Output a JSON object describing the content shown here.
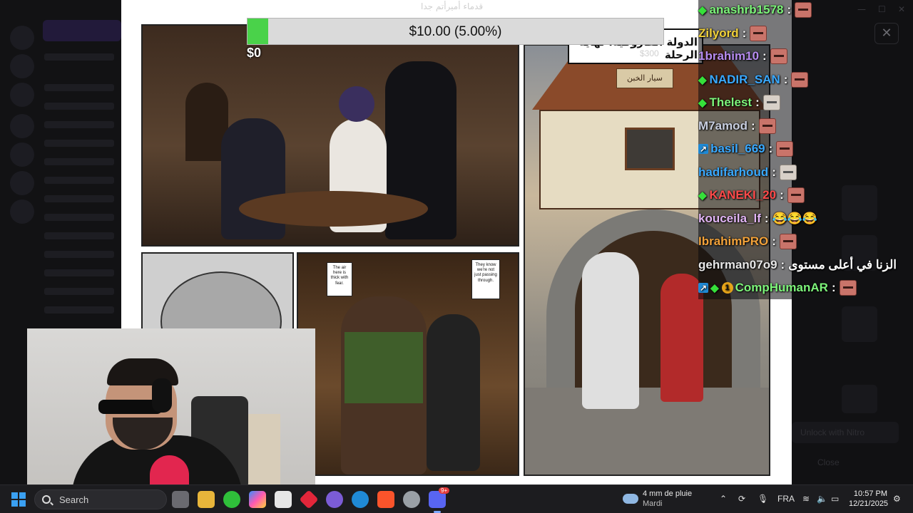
{
  "manga": {
    "header_text": "قدماء أميرأتم جدا",
    "banner_text": "الدولة الفاروقية: نهاية الرحلة",
    "sign_text": "سيار الخبن",
    "bubble1": "The air here is thick with fear.",
    "bubble2": "They know we're not just passing through."
  },
  "donation_goal": {
    "label": "$10.00 (5.00%)",
    "min_label": "$0",
    "max_label": "$300",
    "progress_fraction": 0.05,
    "fill_color": "#4ad24a"
  },
  "chat": {
    "messages": [
      {
        "badges": [
          "green"
        ],
        "user": "anashrb1578",
        "color": "#7df47a",
        "emotes": [
          "face"
        ],
        "text": ""
      },
      {
        "badges": [],
        "user": "Zilyord",
        "color": "#f2d23a",
        "emotes": [
          "face"
        ],
        "text": ""
      },
      {
        "badges": [],
        "user": "1brahim10",
        "color": "#b78cf0",
        "emotes": [
          "face"
        ],
        "text": ""
      },
      {
        "badges": [
          "green"
        ],
        "user": "NADIR_SAN",
        "color": "#3aa9ff",
        "emotes": [
          "face"
        ],
        "text": ""
      },
      {
        "badges": [
          "green"
        ],
        "user": "Thelest",
        "color": "#7df47a",
        "emotes": [
          "pale"
        ],
        "text": ""
      },
      {
        "badges": [],
        "user": "M7amod",
        "color": "#c9cfe0",
        "emotes": [
          "face"
        ],
        "text": ""
      },
      {
        "badges": [
          "blue"
        ],
        "user": "basil_669",
        "color": "#3aa9ff",
        "emotes": [
          "face"
        ],
        "text": ""
      },
      {
        "badges": [],
        "user": "hadifarhoud",
        "color": "#3aa9ff",
        "emotes": [
          "pale"
        ],
        "text": ""
      },
      {
        "badges": [
          "green"
        ],
        "user": "KANEKI_20",
        "color": "#ff4a4a",
        "emotes": [
          "face"
        ],
        "text": ""
      },
      {
        "badges": [],
        "user": "kouceila_lf",
        "color": "#e2b5f5",
        "emotes": [],
        "text": "😂😂😂"
      },
      {
        "badges": [],
        "user": "IbrahimPRO",
        "color": "#f2a23a",
        "emotes": [
          "face"
        ],
        "text": ""
      },
      {
        "badges": [],
        "user": "gehrman07o9",
        "color": "#e8e8e8",
        "emotes": [],
        "text": "الزنا في أعلى مستوى"
      },
      {
        "badges": [
          "blue",
          "green",
          "gold"
        ],
        "user": "CompHumanAR",
        "color": "#7df47a",
        "emotes": [
          "face"
        ],
        "text": ""
      }
    ],
    "separator": ":"
  },
  "right_panel": {
    "unlock_label": "Unlock with Nitro",
    "close_label": "Close",
    "close_icon": "✕"
  },
  "taskbar": {
    "search_label": "Search",
    "weather_main": "4 mm de pluie",
    "weather_sub": "Mardi",
    "language": "FRA",
    "time": "10:57 PM",
    "date": "12/21/2025",
    "discord_badge": "9+"
  }
}
